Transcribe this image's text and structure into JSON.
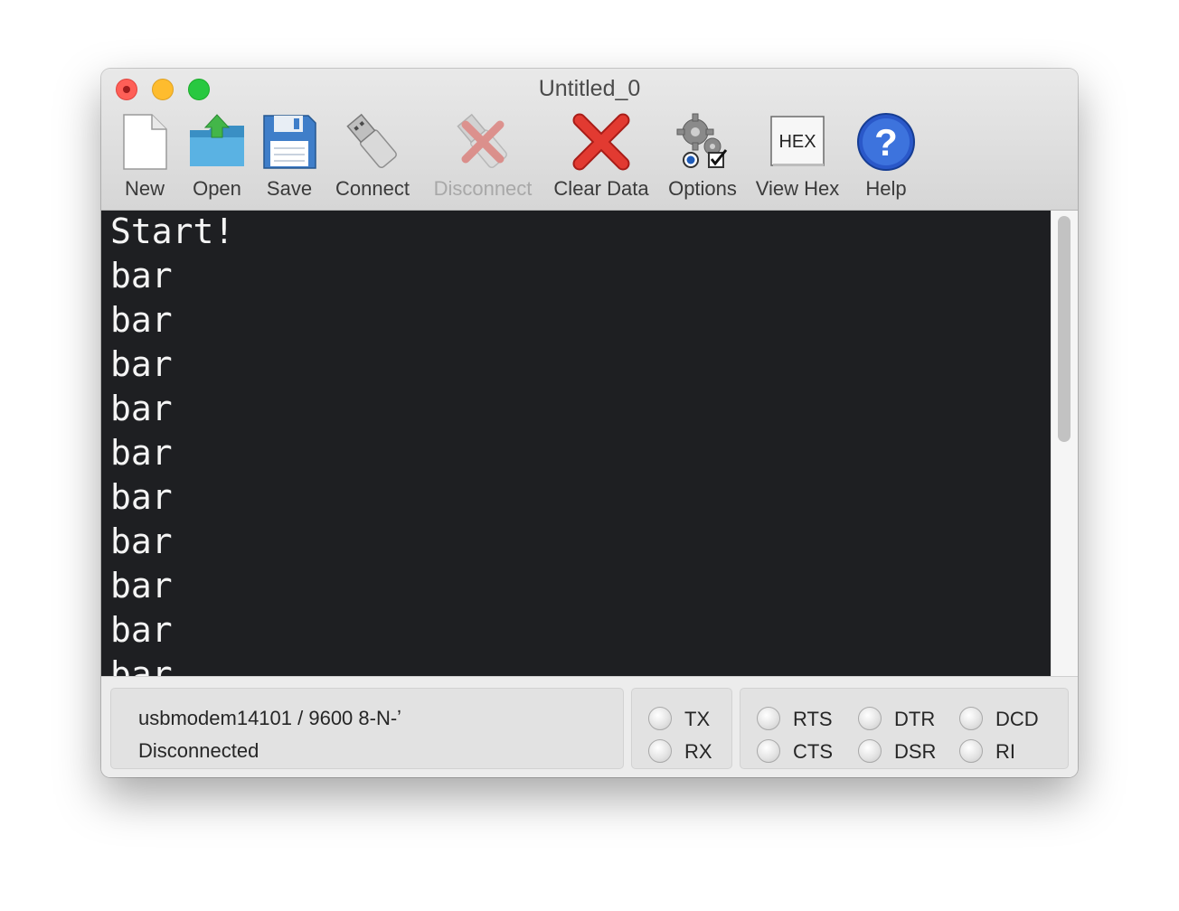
{
  "window": {
    "title": "Untitled_0"
  },
  "toolbar": {
    "items": [
      {
        "label": "New",
        "icon": "new-document-icon",
        "enabled": true
      },
      {
        "label": "Open",
        "icon": "open-folder-icon",
        "enabled": true
      },
      {
        "label": "Save",
        "icon": "floppy-disk-icon",
        "enabled": true
      },
      {
        "label": "Connect",
        "icon": "usb-plug-icon",
        "enabled": true
      },
      {
        "label": "Disconnect",
        "icon": "usb-disconnect-icon",
        "enabled": false
      },
      {
        "label": "Clear Data",
        "icon": "red-x-icon",
        "enabled": true
      },
      {
        "label": "Options",
        "icon": "gears-options-icon",
        "enabled": true
      },
      {
        "label": "View Hex",
        "icon": "hex-icon",
        "enabled": true,
        "icon_text": "HEX"
      },
      {
        "label": "Help",
        "icon": "help-question-icon",
        "enabled": true
      }
    ]
  },
  "terminal": {
    "lines": [
      "Start!",
      "bar",
      "bar",
      "bar",
      "bar",
      "bar",
      "bar",
      "bar",
      "bar",
      "bar",
      "bar"
    ]
  },
  "status": {
    "port_info": "usbmodem14101 / 9600 8-N-ʼ",
    "connection": "Disconnected"
  },
  "indicators": {
    "tx": "TX",
    "rx": "RX",
    "rts": "RTS",
    "cts": "CTS",
    "dtr": "DTR",
    "dsr": "DSR",
    "dcd": "DCD",
    "ri": "RI"
  },
  "colors": {
    "terminal_bg": "#1e1f22",
    "terminal_text": "#f4f4f4",
    "close": "#fe5f57",
    "minimize": "#febc2e",
    "maximize": "#28c840",
    "help_blue": "#2a58c9",
    "clear_red": "#d8322a"
  }
}
